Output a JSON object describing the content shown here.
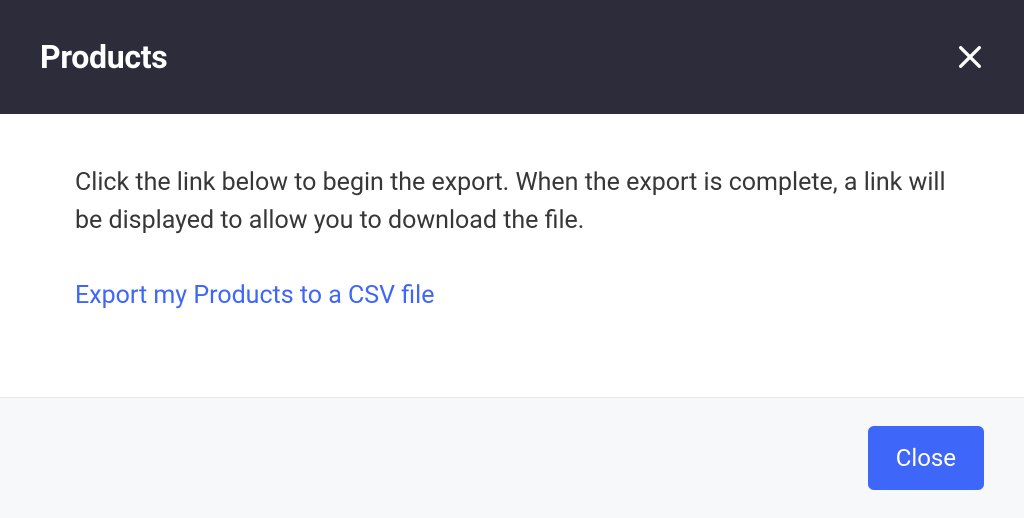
{
  "header": {
    "title": "Products"
  },
  "body": {
    "description": "Click the link below to begin the export. When the export is complete, a link will be displayed to allow you to download the file.",
    "export_link_label": "Export my Products to a CSV file"
  },
  "footer": {
    "close_label": "Close"
  }
}
